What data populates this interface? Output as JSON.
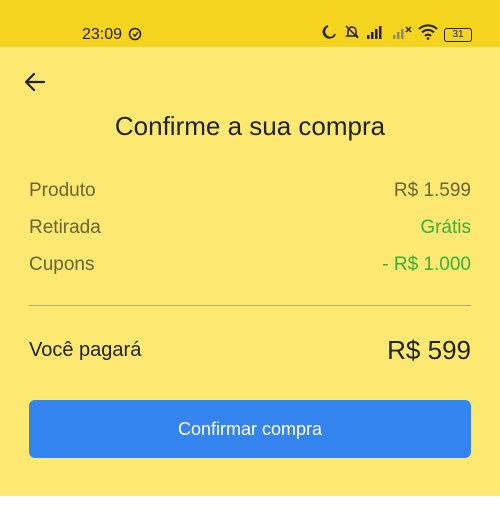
{
  "status_bar": {
    "time": "23:09",
    "battery": "31"
  },
  "header": {
    "title": "Confirme a sua compra"
  },
  "summary": {
    "rows": [
      {
        "label": "Produto",
        "value": "R$ 1.599"
      },
      {
        "label": "Retirada",
        "value": "Grátis"
      },
      {
        "label": "Cupons",
        "value": "- R$ 1.000"
      }
    ]
  },
  "total": {
    "label": "Você pagará",
    "value": "R$ 599"
  },
  "actions": {
    "confirm_label": "Confirmar compra"
  },
  "colors": {
    "status_bar": "#f5d41f",
    "background": "#fde971",
    "accent_green": "#3aaf3a",
    "button_blue": "#3484f0"
  }
}
